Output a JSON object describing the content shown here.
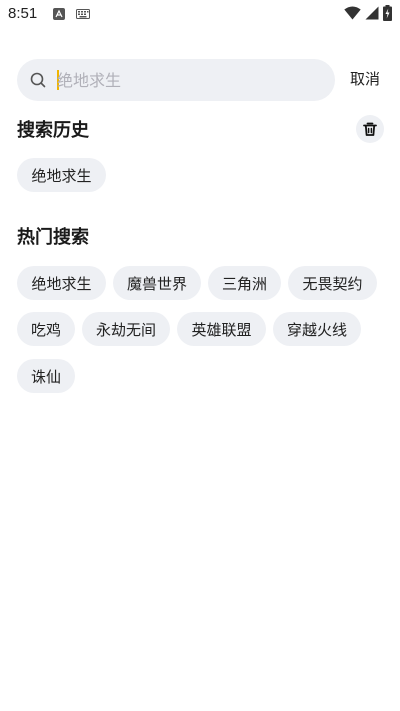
{
  "status_bar": {
    "time": "8:51",
    "icons": [
      "app-store-icon",
      "keyboard-icon",
      "wifi-icon",
      "signal-icon",
      "battery-charging-icon"
    ]
  },
  "search": {
    "placeholder": "绝地求生",
    "cancel_label": "取消",
    "caret_color": "#f0b400"
  },
  "history": {
    "title": "搜索历史",
    "clear_icon": "trash-icon",
    "items": [
      "绝地求生"
    ]
  },
  "hot": {
    "title": "热门搜索",
    "items": [
      "绝地求生",
      "魔兽世界",
      "三角洲",
      "无畏契约",
      "吃鸡",
      "永劫无间",
      "英雄联盟",
      "穿越火线",
      "诛仙"
    ]
  },
  "colors": {
    "chip_background": "#eef0f4",
    "text": "#1f1f1f",
    "placeholder": "#b0b0b8"
  }
}
